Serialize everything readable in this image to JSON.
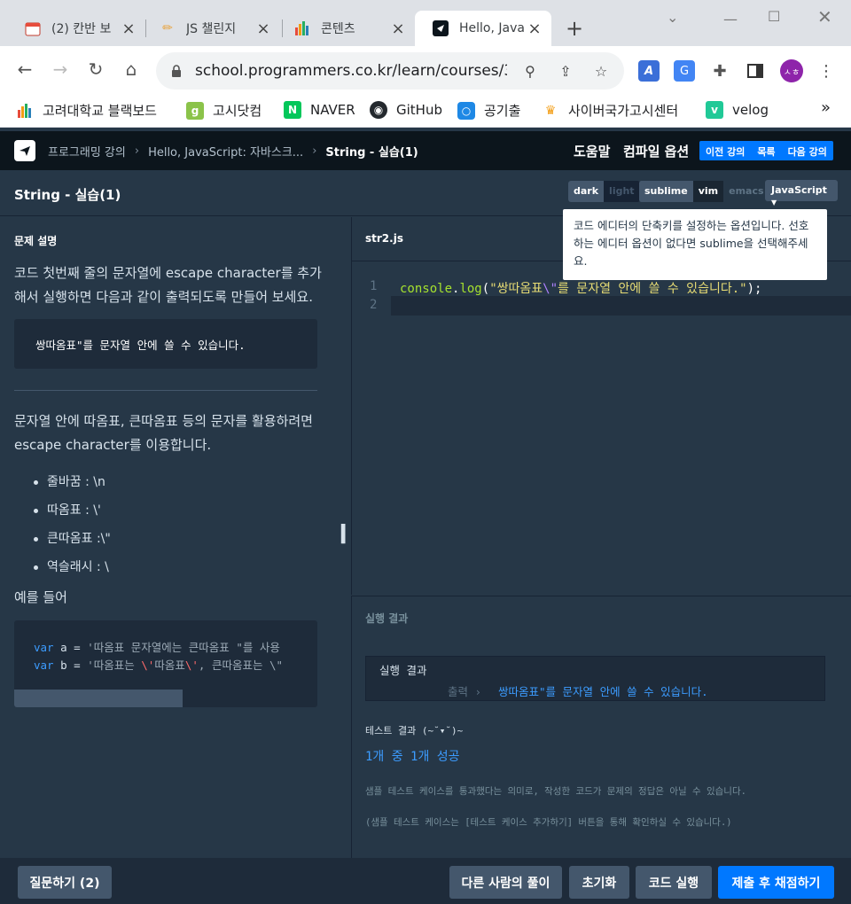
{
  "browser": {
    "tabs": [
      {
        "title": "(2) 칸반 보"
      },
      {
        "title": "JS 챌린지"
      },
      {
        "title": "콘텐츠"
      },
      {
        "title": "Hello, Java"
      }
    ],
    "url": "school.programmers.co.kr/learn/courses/3/l...",
    "profile_initials": "ㅅㅎ",
    "bookmarks": [
      {
        "label": "고려대학교 블랙보드"
      },
      {
        "label": "고시닷컴"
      },
      {
        "label": "NAVER"
      },
      {
        "label": "GitHub"
      },
      {
        "label": "공기출"
      },
      {
        "label": "사이버국가고시센터"
      },
      {
        "label": "velog"
      }
    ],
    "bookmarks_more": "»"
  },
  "app": {
    "breadcrumb": [
      "프로그래밍 강의",
      "Hello, JavaScript: 자바스크...",
      "String - 실습(1)"
    ],
    "help": "도움말",
    "compile_options": "컴파일 옵션",
    "nav": {
      "prev": "이전 강의",
      "list": "목록",
      "next": "다음 강의"
    }
  },
  "titlebar": {
    "title": "String - 실습(1)",
    "theme": {
      "dark": "dark",
      "light": "light"
    },
    "keymap": {
      "sublime": "sublime",
      "vim": "vim",
      "emacs": "emacs"
    },
    "language": "JavaScript",
    "tooltip": "코드 에디터의 단축키를 설정하는 옵션입니다. 선호하는 에디터 옵션이 없다면 sublime을 선택해주세요."
  },
  "problem": {
    "heading": "문제 설명",
    "intro": "코드 첫번째 줄의 문자열에 escape character를 추가해서 실행하면 다음과 같이 출력되도록 만들어 보세요.",
    "expected_output": "쌍따옴표\"를 문자열 안에 쓸 수 있습니다.",
    "para2": "문자열 안에 따옴표, 큰따옴표 등의 문자를 활용하려면 escape character를 이용합니다.",
    "bullets": [
      "줄바꿈 : \\n",
      "따옴표 : \\'",
      "큰따옴표 :\\\"",
      "역슬래시 : \\"
    ],
    "example_label": "예를 들어",
    "example_code": {
      "line1": {
        "kw": "var",
        "rest": " a = ",
        "str": "'따옴표 문자열에는 큰따옴표 \"를 사용"
      },
      "line2": {
        "kw": "var",
        "rest": " b = ",
        "str1": "'따옴표는 ",
        "esc1": "\\'",
        "str2": "따옴표",
        "esc2": "\\'",
        "str3": ", 큰따옴표는 \\\""
      }
    }
  },
  "editor": {
    "filename": "str2.js",
    "line_numbers": [
      "1",
      "2"
    ],
    "code": {
      "obj": "console",
      "dot": ".",
      "fn": "log",
      "open": "(",
      "str_a": "\"쌍따옴표",
      "esc": "\\\"",
      "str_b": "를 문자열 안에 쓸 수 있습니다.\"",
      "close": ");"
    }
  },
  "result": {
    "heading": "실행 결과",
    "console_title": "실행 결과",
    "output_label": "출력",
    "output_value": "쌍따옴표\"를 문자열 안에 쓸 수 있습니다.",
    "test_heading": "테스트 결과 (~˘▾˘)~",
    "test_summary": "1개 중 1개 성공",
    "note1": "샘플 테스트 케이스를 통과했다는 의미로, 작성한 코드가 문제의 정답은 아닐 수 있습니다.",
    "note2": "(샘플 테스트 케이스는 [테스트 케이스 추가하기] 버튼을 통해 확인하실 수 있습니다.)"
  },
  "footer": {
    "ask": "질문하기 (2)",
    "others": "다른 사람의 풀이",
    "reset": "초기화",
    "run": "코드 실행",
    "submit": "제출 후 채점하기"
  },
  "colors": {
    "accent": "#0078ff",
    "bg": "#263747",
    "header": "#0c151c"
  }
}
